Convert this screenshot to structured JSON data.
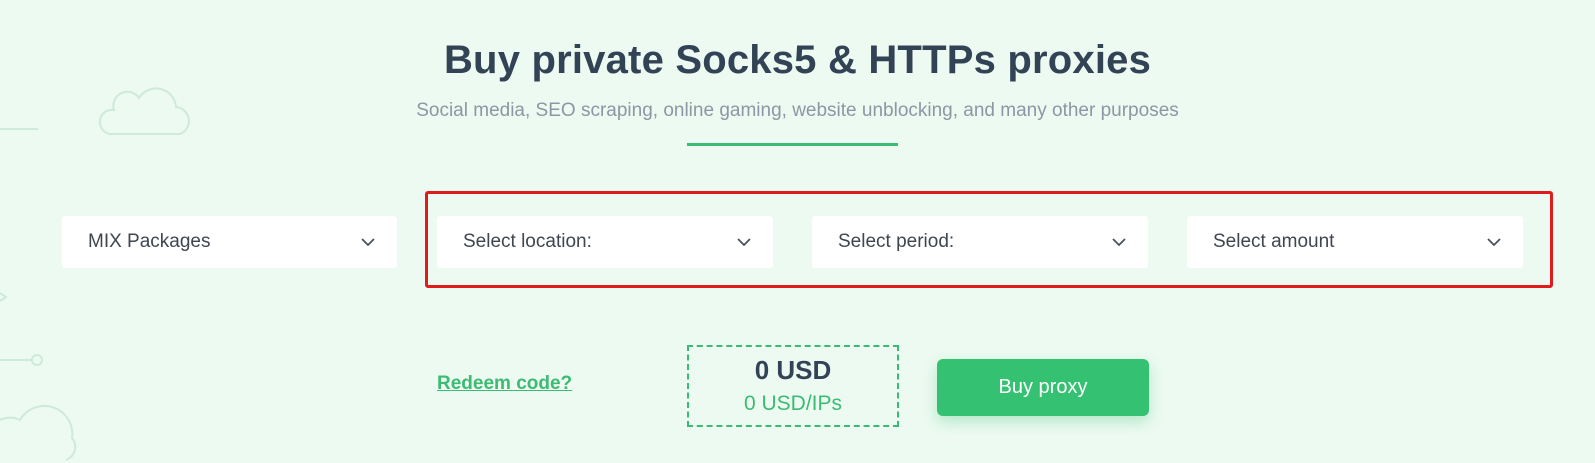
{
  "hero": {
    "title": "Buy private Socks5 & HTTPs proxies",
    "subtitle": "Social media, SEO scraping, online gaming, website unblocking, and many other purposes"
  },
  "filters": {
    "package": "MIX Packages",
    "location": "Select location:",
    "period": "Select period:",
    "amount": "Select amount"
  },
  "checkout": {
    "redeem_label": "Redeem code?",
    "total": "0 USD",
    "per_ip": "0 USD/IPs",
    "buy_label": "Buy proxy"
  },
  "colors": {
    "background": "#ecfaf1",
    "accent": "#3cbb73",
    "button": "#35c172",
    "title": "#334356",
    "highlight": "#e01b1b"
  },
  "icons": {
    "dropdown": "chevron-down-icon",
    "decoration": "cloud-icon"
  }
}
